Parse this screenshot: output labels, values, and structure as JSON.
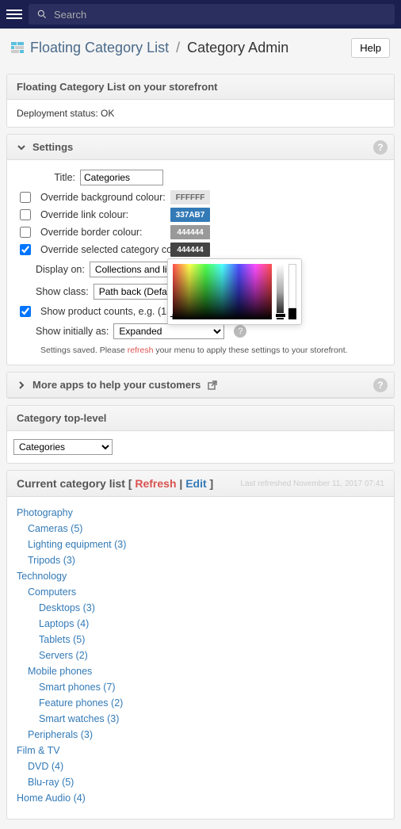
{
  "topbar": {
    "search_placeholder": "Search"
  },
  "header": {
    "breadcrumb_app": "Floating Category List",
    "breadcrumb_page": "Category Admin",
    "help_label": "Help"
  },
  "storefront_panel": {
    "title": "Floating Category List on your storefront",
    "status": "Deployment status: OK"
  },
  "settings": {
    "title": "Settings",
    "title_label": "Title:",
    "title_value": "Categories",
    "override_bg_label": "Override background colour:",
    "override_bg_value": "FFFFFF",
    "override_link_label": "Override link colour:",
    "override_link_value": "337AB7",
    "override_border_label": "Override border colour:",
    "override_border_value": "444444",
    "override_selected_label": "Override selected category colour:",
    "override_selected_value": "444444",
    "display_on_label": "Display on:",
    "display_on_value": "Collections and linked pages",
    "show_class_label": "Show class:",
    "show_class_value": "Path back (Default)",
    "show_counts_label": "Show product counts, e.g. (13)",
    "show_initially_label": "Show initially as:",
    "show_initially_value": "Expanded",
    "saved_msg_pre": "Settings saved. Please ",
    "saved_msg_link": "refresh",
    "saved_msg_post": " your menu to apply these settings to your storefront."
  },
  "more_apps": {
    "title": "More apps to help your customers"
  },
  "toplevel": {
    "title": "Category top-level",
    "value": "Categories"
  },
  "catlist": {
    "title_pre": "Current category list [ ",
    "refresh": "Refresh",
    "sep": " | ",
    "edit": "Edit",
    "title_post": " ]",
    "last_refreshed": "Last refreshed November 11, 2017 07:41",
    "tree": [
      {
        "label": "Photography",
        "level": 0
      },
      {
        "label": "Cameras (5)",
        "level": 1
      },
      {
        "label": "Lighting equipment (3)",
        "level": 1
      },
      {
        "label": "Tripods (3)",
        "level": 1
      },
      {
        "label": "Technology",
        "level": 0
      },
      {
        "label": "Computers",
        "level": 1
      },
      {
        "label": "Desktops (3)",
        "level": 2
      },
      {
        "label": "Laptops (4)",
        "level": 2
      },
      {
        "label": "Tablets (5)",
        "level": 2
      },
      {
        "label": "Servers (2)",
        "level": 2
      },
      {
        "label": "Mobile phones",
        "level": 1
      },
      {
        "label": "Smart phones (7)",
        "level": 2
      },
      {
        "label": "Feature phones (2)",
        "level": 2
      },
      {
        "label": "Smart watches (3)",
        "level": 2
      },
      {
        "label": "Peripherals (3)",
        "level": 1
      },
      {
        "label": "Film & TV",
        "level": 0
      },
      {
        "label": "DVD (4)",
        "level": 1
      },
      {
        "label": "Blu-ray (5)",
        "level": 1
      },
      {
        "label": "Home Audio (4)",
        "level": 0
      }
    ]
  }
}
